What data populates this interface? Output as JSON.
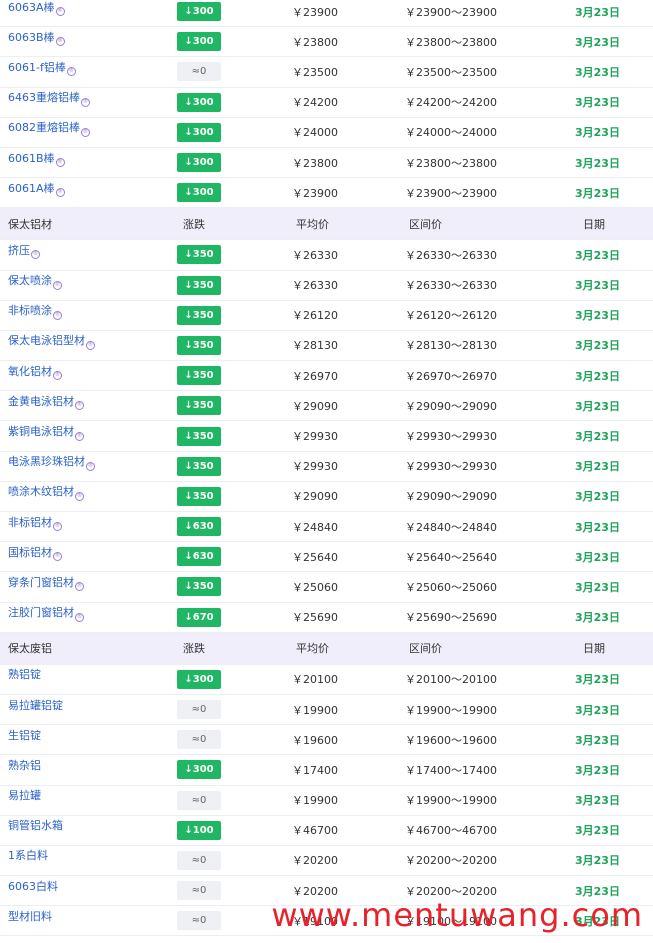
{
  "header_labels": {
    "change": "涨跌",
    "avg": "平均价",
    "range": "区间价",
    "date": "日期"
  },
  "top_rows": [
    {
      "name": "6063A棒",
      "change": "↓300",
      "trend": "down",
      "avg": "￥23900",
      "range": "￥23900～23900",
      "date": "3月23日"
    },
    {
      "name": "6063B棒",
      "change": "↓300",
      "trend": "down",
      "avg": "￥23800",
      "range": "￥23800～23800",
      "date": "3月23日"
    },
    {
      "name": "6061-f铝棒",
      "change": "≈0",
      "trend": "flat",
      "avg": "￥23500",
      "range": "￥23500～23500",
      "date": "3月23日"
    },
    {
      "name": "6463重熔铝棒",
      "change": "↓300",
      "trend": "down",
      "avg": "￥24200",
      "range": "￥24200～24200",
      "date": "3月23日"
    },
    {
      "name": "6082重熔铝棒",
      "change": "↓300",
      "trend": "down",
      "avg": "￥24000",
      "range": "￥24000～24000",
      "date": "3月23日"
    },
    {
      "name": "6061B棒",
      "change": "↓300",
      "trend": "down",
      "avg": "￥23800",
      "range": "￥23800～23800",
      "date": "3月23日"
    },
    {
      "name": "6061A棒",
      "change": "↓300",
      "trend": "down",
      "avg": "￥23900",
      "range": "￥23900～23900",
      "date": "3月23日"
    }
  ],
  "section1": {
    "title": "保太铝材",
    "rows": [
      {
        "name": "挤压",
        "change": "↓350",
        "trend": "down",
        "avg": "￥26330",
        "range": "￥26330～26330",
        "date": "3月23日"
      },
      {
        "name": "保太喷涂",
        "change": "↓350",
        "trend": "down",
        "avg": "￥26330",
        "range": "￥26330～26330",
        "date": "3月23日"
      },
      {
        "name": "非标喷涂",
        "change": "↓350",
        "trend": "down",
        "avg": "￥26120",
        "range": "￥26120～26120",
        "date": "3月23日"
      },
      {
        "name": "保太电泳铝型材",
        "change": "↓350",
        "trend": "down",
        "avg": "￥28130",
        "range": "￥28130～28130",
        "date": "3月23日"
      },
      {
        "name": "氧化铝材",
        "change": "↓350",
        "trend": "down",
        "avg": "￥26970",
        "range": "￥26970～26970",
        "date": "3月23日"
      },
      {
        "name": "金黄电泳铝材",
        "change": "↓350",
        "trend": "down",
        "avg": "￥29090",
        "range": "￥29090～29090",
        "date": "3月23日"
      },
      {
        "name": "紫铜电泳铝材",
        "change": "↓350",
        "trend": "down",
        "avg": "￥29930",
        "range": "￥29930～29930",
        "date": "3月23日"
      },
      {
        "name": "电泳黑珍珠铝材",
        "change": "↓350",
        "trend": "down",
        "avg": "￥29930",
        "range": "￥29930～29930",
        "date": "3月23日"
      },
      {
        "name": "喷涂木纹铝材",
        "change": "↓350",
        "trend": "down",
        "avg": "￥29090",
        "range": "￥29090～29090",
        "date": "3月23日"
      },
      {
        "name": "非标铝材",
        "change": "↓630",
        "trend": "down",
        "avg": "￥24840",
        "range": "￥24840～24840",
        "date": "3月23日"
      },
      {
        "name": "国标铝材",
        "change": "↓630",
        "trend": "down",
        "avg": "￥25640",
        "range": "￥25640～25640",
        "date": "3月23日"
      },
      {
        "name": "穿条门窗铝材",
        "change": "↓350",
        "trend": "down",
        "avg": "￥25060",
        "range": "￥25060～25060",
        "date": "3月23日"
      },
      {
        "name": "注胶门窗铝材",
        "change": "↓670",
        "trend": "down",
        "avg": "￥25690",
        "range": "￥25690～25690",
        "date": "3月23日"
      }
    ]
  },
  "section2": {
    "title": "保太废铝",
    "rows": [
      {
        "name": "熟铝锭",
        "change": "↓300",
        "trend": "down",
        "avg": "￥20100",
        "range": "￥20100～20100",
        "date": "3月23日"
      },
      {
        "name": "易拉罐铝锭",
        "change": "≈0",
        "trend": "flat",
        "avg": "￥19900",
        "range": "￥19900～19900",
        "date": "3月23日"
      },
      {
        "name": "生铝锭",
        "change": "≈0",
        "trend": "flat",
        "avg": "￥19600",
        "range": "￥19600～19600",
        "date": "3月23日"
      },
      {
        "name": "熟杂铝",
        "change": "↓300",
        "trend": "down",
        "avg": "￥17400",
        "range": "￥17400～17400",
        "date": "3月23日"
      },
      {
        "name": "易拉罐",
        "change": "≈0",
        "trend": "flat",
        "avg": "￥19900",
        "range": "￥19900～19900",
        "date": "3月23日"
      },
      {
        "name": "铜管铝水箱",
        "change": "↓100",
        "trend": "down",
        "avg": "￥46700",
        "range": "￥46700～46700",
        "date": "3月23日"
      },
      {
        "name": "1系白料",
        "change": "≈0",
        "trend": "flat",
        "avg": "￥20200",
        "range": "￥20200～20200",
        "date": "3月23日"
      },
      {
        "name": "6063白料",
        "change": "≈0",
        "trend": "flat",
        "avg": "￥20200",
        "range": "￥20200～20200",
        "date": "3月23日"
      },
      {
        "name": "型材旧料",
        "change": "≈0",
        "trend": "flat",
        "avg": "￥19100",
        "range": "￥19100～19100",
        "date": "3月23日"
      }
    ]
  },
  "watermark": "www.mentuwang.com",
  "colors": {
    "down": "#1fb763",
    "date": "#1fa35b",
    "link": "#2b62c8",
    "header_bg": "#f1eefb"
  }
}
